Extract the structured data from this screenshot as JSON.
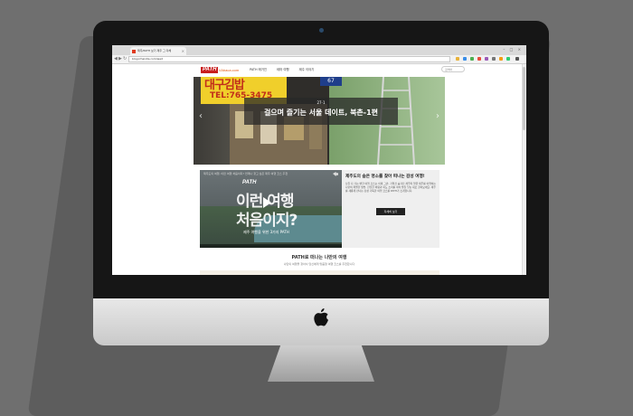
{
  "browser": {
    "tab_title": "제주/PATH 보기 제주 그 자체",
    "tab_close": "×",
    "window_controls": "– □ ×",
    "url": "blog.irhandis.com/wed",
    "back": "◀",
    "forward": "▶",
    "reload": "↻"
  },
  "site": {
    "logo": "PATH",
    "logo_sub": "//Abaca.com",
    "nav": [
      "PATH 매거진",
      "테마 여행",
      "제주 이야기"
    ],
    "search_placeholder": "검색어"
  },
  "hero": {
    "sign_text": "대구김밥",
    "sign_tel": "TEL:765-3475",
    "blue_sign": "67",
    "number": "27-1",
    "title": "걸으며 즐기는 서울 데이트, 북촌-1편",
    "prev": "‹",
    "next": "›"
  },
  "promo": {
    "video_header": "제주도의 여행, 이런 여행 처음이지? 언제나 찾고 싶은 제주 여행 코스 추천",
    "video_logo": "PATH",
    "video_line1": "이런 여행",
    "video_line2": "처음이지?",
    "video_sub": "제주 여행을 위한 3가지 PATH",
    "title": "제주도의 숨은 명소를 찾아 떠나는 감성 여행!",
    "body": "남들 다 가는 뻔한 여행 코스는 이제 그만, 가려진 숨겨진 제주의 얼굴 제주를 여행하는 나만의 특별한 방법. 잔잔한 바람과 파도 소리를 따라 발길 닿는 대로 걸어보세요. 제주를 새롭게 만나는 감성 가득한 여행 코스를 PATH가 소개합니다.",
    "button": "자세히 보기"
  },
  "section": {
    "title": "PATH로 떠나는 나만의 여행",
    "subtitle": "나만의 여행을 찾아서 당신에게 맞춤형 여행 코스를 추천합니다"
  },
  "colors": {
    "brand_red": "#c81e1e",
    "bezel": "#161616",
    "background": "#6f6f6f"
  }
}
